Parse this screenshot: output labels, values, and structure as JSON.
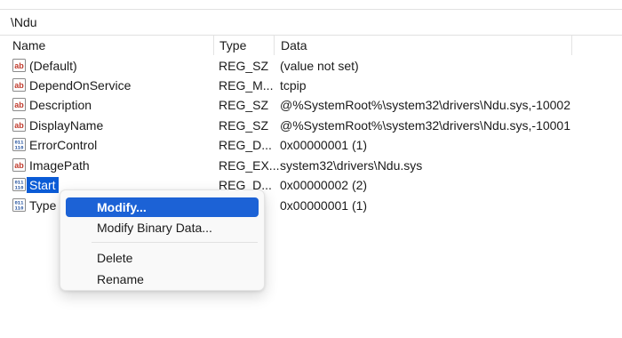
{
  "path": "\\Ndu",
  "columns": {
    "name": "Name",
    "type": "Type",
    "data": "Data"
  },
  "rows": [
    {
      "icon": "string-value-icon",
      "name": "(Default)",
      "type": "REG_SZ",
      "data": "(value not set)"
    },
    {
      "icon": "string-value-icon",
      "name": "DependOnService",
      "type": "REG_M...",
      "data": "tcpip"
    },
    {
      "icon": "string-value-icon",
      "name": "Description",
      "type": "REG_SZ",
      "data": "@%SystemRoot%\\system32\\drivers\\Ndu.sys,-10002"
    },
    {
      "icon": "string-value-icon",
      "name": "DisplayName",
      "type": "REG_SZ",
      "data": "@%SystemRoot%\\system32\\drivers\\Ndu.sys,-10001"
    },
    {
      "icon": "binary-value-icon",
      "name": "ErrorControl",
      "type": "REG_D...",
      "data": "0x00000001 (1)"
    },
    {
      "icon": "string-value-icon",
      "name": "ImagePath",
      "type": "REG_EX...",
      "data": "system32\\drivers\\Ndu.sys"
    },
    {
      "icon": "binary-value-icon",
      "name": "Start",
      "type": "REG_D...",
      "data": "0x00000002 (2)",
      "selected": true
    },
    {
      "icon": "binary-value-icon",
      "name": "Type",
      "type": "",
      "data": "0x00000001 (1)"
    }
  ],
  "context_menu": {
    "items": [
      "Modify...",
      "Modify Binary Data...",
      "Delete",
      "Rename"
    ],
    "active_item": "Modify..."
  },
  "colors": {
    "selection": "#0a5bd6",
    "menu_highlight": "#1c62d6"
  }
}
